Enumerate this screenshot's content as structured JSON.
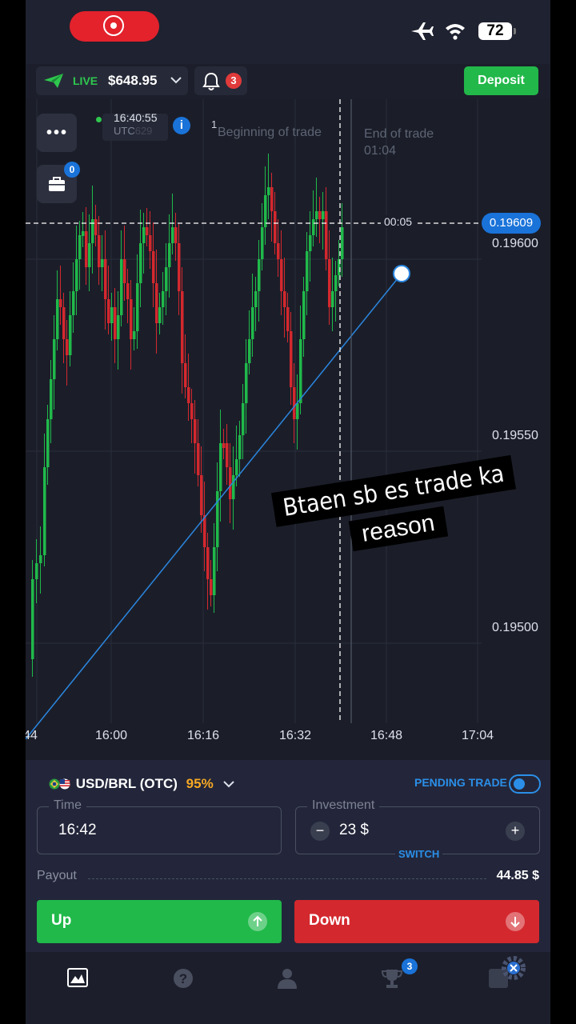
{
  "status": {
    "battery": "72"
  },
  "account": {
    "mode": "LIVE",
    "balance": "$648.95",
    "notifications": "3",
    "deposit_label": "Deposit"
  },
  "chart_header": {
    "server_time": "16:40:55",
    "server_tz": "UTC",
    "server_tz_faded": "629",
    "portfolio_count": "0",
    "marker_one": "1",
    "beginning_label": "Beginning of trade",
    "end_label": "End of trade",
    "end_time": "01:04"
  },
  "chart_data": {
    "type": "candlestick",
    "y_ticks": [
      "0.19600",
      "0.19550",
      "0.19500"
    ],
    "x_ticks": [
      "44",
      "16:00",
      "16:16",
      "16:32",
      "16:48",
      "17:04"
    ],
    "current_price": "0.19609",
    "countdown": "00:05",
    "ylim": [
      0.1947,
      0.1965
    ]
  },
  "overlay_text": {
    "line1": "Btaen sb es trade ka",
    "line2": "reason"
  },
  "trade": {
    "pair": "USD/BRL (OTC)",
    "payout_pct": "95%",
    "pending_label": "PENDING TRADE",
    "time_label": "Time",
    "time_value": "16:42",
    "investment_label": "Investment",
    "investment_value": "23 $",
    "switch_label": "SWITCH",
    "payout_label": "Payout",
    "payout_value": "44.85 $",
    "up_label": "Up",
    "down_label": "Down"
  },
  "nav": {
    "tournaments_badge": "3"
  },
  "colors": {
    "up": "#20b94a",
    "down": "#d3282e",
    "accent": "#1a73d9"
  }
}
